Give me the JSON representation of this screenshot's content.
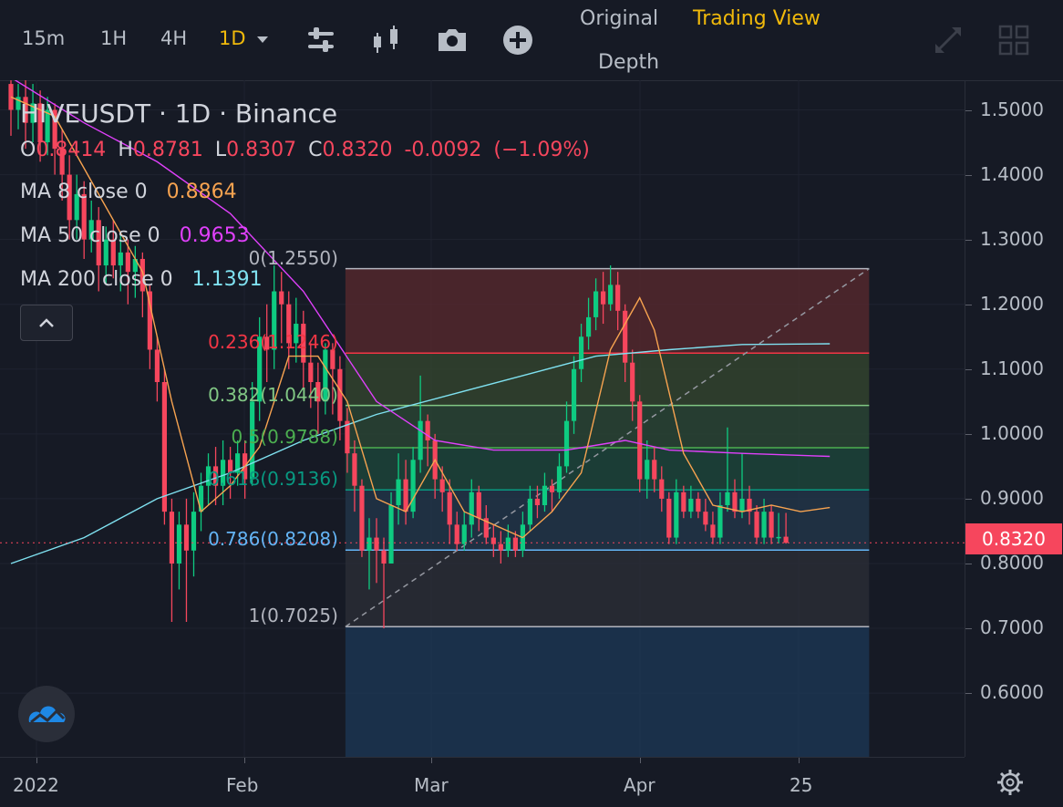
{
  "toolbar": {
    "timeframes": [
      "15m",
      "1H",
      "4H",
      "1D"
    ],
    "active_timeframe": "1D",
    "icons": [
      "indicator-settings-icon",
      "candle-type-icon",
      "camera-icon",
      "add-icon"
    ],
    "tabs": {
      "original": "Original",
      "trading_view": "Trading View",
      "depth": "Depth"
    },
    "right_icons": [
      "fullscreen-icon",
      "layout-grid-icon"
    ]
  },
  "legend": {
    "title": "HIVEUSDT · 1D · Binance",
    "ohlc": {
      "o_label": "O",
      "o": "0.8414",
      "h_label": "H",
      "h": "0.8781",
      "l_label": "L",
      "l": "0.8307",
      "c_label": "C",
      "c": "0.8320",
      "change": "-0.0092",
      "change_pct": "(−1.09%)"
    },
    "ma8": {
      "label": "MA 8 close 0",
      "value": "0.8864",
      "color": "#f7a350"
    },
    "ma50": {
      "label": "MA 50 close 0",
      "value": "0.9653",
      "color": "#e040fb"
    },
    "ma200": {
      "label": "MA 200 close 0",
      "value": "1.1391",
      "color": "#7fe1f0"
    }
  },
  "price_axis": {
    "labels": [
      "1.5000",
      "1.4000",
      "1.3000",
      "1.2000",
      "1.1000",
      "1.0000",
      "0.9000",
      "0.8000",
      "0.7000",
      "0.6000"
    ],
    "current_price": "0.8320"
  },
  "time_axis": {
    "labels": [
      "2022",
      "Feb",
      "Mar",
      "Apr",
      "25"
    ]
  },
  "fib_levels": [
    {
      "label": "0(1.2550)",
      "color": "#b2b5be"
    },
    {
      "label": "0.236(1.1246)",
      "color": "#f23645"
    },
    {
      "label": "0.382(1.0440)",
      "color": "#81c784"
    },
    {
      "label": "0.5(0.9788)",
      "color": "#4caf50"
    },
    {
      "label": "0.618(0.9136)",
      "color": "#089981"
    },
    {
      "label": "0.786(0.8208)",
      "color": "#64b5f6"
    },
    {
      "label": "1(0.7025)",
      "color": "#b2b5be"
    }
  ],
  "colors": {
    "up": "#0ecb81",
    "down": "#f6465d",
    "accent": "#f0b90b",
    "background": "#161a25"
  },
  "chart_data": {
    "type": "candlestick",
    "symbol": "HIVEUSDT",
    "interval": "1D",
    "ylim": [
      0.5,
      1.54
    ],
    "candles": [
      {
        "o": 1.54,
        "c": 1.5,
        "h": 1.56,
        "l": 1.46
      },
      {
        "o": 1.5,
        "c": 1.52,
        "h": 1.54,
        "l": 1.47
      },
      {
        "o": 1.52,
        "c": 1.48,
        "h": 1.55,
        "l": 1.44
      },
      {
        "o": 1.48,
        "c": 1.51,
        "h": 1.54,
        "l": 1.45
      },
      {
        "o": 1.51,
        "c": 1.45,
        "h": 1.53,
        "l": 1.42
      },
      {
        "o": 1.45,
        "c": 1.5,
        "h": 1.52,
        "l": 1.43
      },
      {
        "o": 1.5,
        "c": 1.44,
        "h": 1.51,
        "l": 1.4
      },
      {
        "o": 1.44,
        "c": 1.4,
        "h": 1.47,
        "l": 1.36
      },
      {
        "o": 1.4,
        "c": 1.33,
        "h": 1.43,
        "l": 1.3
      },
      {
        "o": 1.33,
        "c": 1.37,
        "h": 1.4,
        "l": 1.3
      },
      {
        "o": 1.37,
        "c": 1.3,
        "h": 1.39,
        "l": 1.27
      },
      {
        "o": 1.3,
        "c": 1.33,
        "h": 1.36,
        "l": 1.28
      },
      {
        "o": 1.33,
        "c": 1.26,
        "h": 1.35,
        "l": 1.22
      },
      {
        "o": 1.26,
        "c": 1.3,
        "h": 1.32,
        "l": 1.23
      },
      {
        "o": 1.3,
        "c": 1.26,
        "h": 1.33,
        "l": 1.24
      },
      {
        "o": 1.26,
        "c": 1.28,
        "h": 1.31,
        "l": 1.22
      },
      {
        "o": 1.28,
        "c": 1.25,
        "h": 1.3,
        "l": 1.2
      },
      {
        "o": 1.25,
        "c": 1.27,
        "h": 1.29,
        "l": 1.21
      },
      {
        "o": 1.27,
        "c": 1.22,
        "h": 1.28,
        "l": 1.18
      },
      {
        "o": 1.22,
        "c": 1.13,
        "h": 1.23,
        "l": 1.1
      },
      {
        "o": 1.13,
        "c": 1.08,
        "h": 1.15,
        "l": 1.05
      },
      {
        "o": 1.08,
        "c": 0.88,
        "h": 1.1,
        "l": 0.86
      },
      {
        "o": 0.88,
        "c": 0.8,
        "h": 0.9,
        "l": 0.71
      },
      {
        "o": 0.8,
        "c": 0.86,
        "h": 0.88,
        "l": 0.76
      },
      {
        "o": 0.86,
        "c": 0.82,
        "h": 0.9,
        "l": 0.71
      },
      {
        "o": 0.82,
        "c": 0.88,
        "h": 0.91,
        "l": 0.78
      },
      {
        "o": 0.88,
        "c": 0.92,
        "h": 0.94,
        "l": 0.85
      },
      {
        "o": 0.92,
        "c": 0.95,
        "h": 0.97,
        "l": 0.89
      },
      {
        "o": 0.95,
        "c": 0.92,
        "h": 0.98,
        "l": 0.89
      },
      {
        "o": 0.92,
        "c": 0.96,
        "h": 0.99,
        "l": 0.89
      },
      {
        "o": 0.96,
        "c": 0.94,
        "h": 0.98,
        "l": 0.9
      },
      {
        "o": 0.94,
        "c": 0.97,
        "h": 0.99,
        "l": 0.92
      },
      {
        "o": 0.97,
        "c": 0.93,
        "h": 0.99,
        "l": 0.9
      },
      {
        "o": 0.93,
        "c": 1.05,
        "h": 1.08,
        "l": 0.92
      },
      {
        "o": 1.05,
        "c": 1.15,
        "h": 1.18,
        "l": 1.02
      },
      {
        "o": 1.15,
        "c": 1.13,
        "h": 1.2,
        "l": 1.08
      },
      {
        "o": 1.13,
        "c": 1.22,
        "h": 1.26,
        "l": 1.1
      },
      {
        "o": 1.22,
        "c": 1.2,
        "h": 1.25,
        "l": 1.14
      },
      {
        "o": 1.2,
        "c": 1.14,
        "h": 1.22,
        "l": 1.1
      },
      {
        "o": 1.14,
        "c": 1.17,
        "h": 1.21,
        "l": 1.11
      },
      {
        "o": 1.17,
        "c": 1.11,
        "h": 1.19,
        "l": 1.07
      },
      {
        "o": 1.11,
        "c": 1.08,
        "h": 1.14,
        "l": 1.04
      },
      {
        "o": 1.08,
        "c": 1.05,
        "h": 1.11,
        "l": 1.0
      },
      {
        "o": 1.05,
        "c": 1.13,
        "h": 1.14,
        "l": 1.03
      },
      {
        "o": 1.13,
        "c": 1.1,
        "h": 1.14,
        "l": 1.03
      },
      {
        "o": 1.1,
        "c": 1.02,
        "h": 1.12,
        "l": 0.99
      },
      {
        "o": 1.02,
        "c": 0.97,
        "h": 1.04,
        "l": 0.94
      },
      {
        "o": 0.97,
        "c": 0.92,
        "h": 0.99,
        "l": 0.88
      },
      {
        "o": 0.92,
        "c": 0.82,
        "h": 0.93,
        "l": 0.81
      },
      {
        "o": 0.82,
        "c": 0.84,
        "h": 0.87,
        "l": 0.76
      },
      {
        "o": 0.84,
        "c": 0.82,
        "h": 0.87,
        "l": 0.77
      },
      {
        "o": 0.82,
        "c": 0.8,
        "h": 0.84,
        "l": 0.7
      },
      {
        "o": 0.8,
        "c": 0.89,
        "h": 0.91,
        "l": 0.8
      },
      {
        "o": 0.89,
        "c": 0.93,
        "h": 0.97,
        "l": 0.86
      },
      {
        "o": 0.93,
        "c": 0.88,
        "h": 0.96,
        "l": 0.86
      },
      {
        "o": 0.88,
        "c": 0.96,
        "h": 0.98,
        "l": 0.87
      },
      {
        "o": 0.96,
        "c": 1.02,
        "h": 1.09,
        "l": 0.94
      },
      {
        "o": 1.02,
        "c": 0.99,
        "h": 1.03,
        "l": 0.95
      },
      {
        "o": 0.99,
        "c": 0.93,
        "h": 1.0,
        "l": 0.9
      },
      {
        "o": 0.93,
        "c": 0.91,
        "h": 0.95,
        "l": 0.88
      },
      {
        "o": 0.91,
        "c": 0.86,
        "h": 0.93,
        "l": 0.83
      },
      {
        "o": 0.86,
        "c": 0.83,
        "h": 0.88,
        "l": 0.82
      },
      {
        "o": 0.83,
        "c": 0.86,
        "h": 0.88,
        "l": 0.82
      },
      {
        "o": 0.86,
        "c": 0.91,
        "h": 0.93,
        "l": 0.84
      },
      {
        "o": 0.91,
        "c": 0.87,
        "h": 0.92,
        "l": 0.85
      },
      {
        "o": 0.87,
        "c": 0.84,
        "h": 0.89,
        "l": 0.83
      },
      {
        "o": 0.84,
        "c": 0.83,
        "h": 0.86,
        "l": 0.81
      },
      {
        "o": 0.83,
        "c": 0.82,
        "h": 0.85,
        "l": 0.8
      },
      {
        "o": 0.82,
        "c": 0.84,
        "h": 0.86,
        "l": 0.81
      },
      {
        "o": 0.84,
        "c": 0.82,
        "h": 0.85,
        "l": 0.81
      },
      {
        "o": 0.82,
        "c": 0.86,
        "h": 0.88,
        "l": 0.81
      },
      {
        "o": 0.86,
        "c": 0.9,
        "h": 0.92,
        "l": 0.85
      },
      {
        "o": 0.9,
        "c": 0.89,
        "h": 0.92,
        "l": 0.87
      },
      {
        "o": 0.89,
        "c": 0.92,
        "h": 0.94,
        "l": 0.88
      },
      {
        "o": 0.92,
        "c": 0.91,
        "h": 0.93,
        "l": 0.88
      },
      {
        "o": 0.91,
        "c": 0.95,
        "h": 0.97,
        "l": 0.9
      },
      {
        "o": 0.95,
        "c": 1.02,
        "h": 1.05,
        "l": 0.94
      },
      {
        "o": 1.02,
        "c": 1.1,
        "h": 1.12,
        "l": 1.0
      },
      {
        "o": 1.1,
        "c": 1.15,
        "h": 1.17,
        "l": 1.08
      },
      {
        "o": 1.15,
        "c": 1.18,
        "h": 1.21,
        "l": 1.13
      },
      {
        "o": 1.18,
        "c": 1.22,
        "h": 1.24,
        "l": 1.16
      },
      {
        "o": 1.22,
        "c": 1.2,
        "h": 1.25,
        "l": 1.17
      },
      {
        "o": 1.2,
        "c": 1.23,
        "h": 1.26,
        "l": 1.19
      },
      {
        "o": 1.23,
        "c": 1.19,
        "h": 1.25,
        "l": 1.16
      },
      {
        "o": 1.19,
        "c": 1.11,
        "h": 1.2,
        "l": 1.08
      },
      {
        "o": 1.11,
        "c": 1.05,
        "h": 1.13,
        "l": 1.02
      },
      {
        "o": 1.05,
        "c": 0.93,
        "h": 1.06,
        "l": 0.91
      },
      {
        "o": 0.93,
        "c": 0.96,
        "h": 0.99,
        "l": 0.9
      },
      {
        "o": 0.96,
        "c": 0.93,
        "h": 0.98,
        "l": 0.91
      },
      {
        "o": 0.93,
        "c": 0.9,
        "h": 0.95,
        "l": 0.88
      },
      {
        "o": 0.9,
        "c": 0.84,
        "h": 0.91,
        "l": 0.83
      },
      {
        "o": 0.84,
        "c": 0.91,
        "h": 0.93,
        "l": 0.83
      },
      {
        "o": 0.91,
        "c": 0.88,
        "h": 0.92,
        "l": 0.87
      },
      {
        "o": 0.88,
        "c": 0.9,
        "h": 0.92,
        "l": 0.87
      },
      {
        "o": 0.9,
        "c": 0.88,
        "h": 0.91,
        "l": 0.87
      },
      {
        "o": 0.88,
        "c": 0.86,
        "h": 0.9,
        "l": 0.85
      },
      {
        "o": 0.86,
        "c": 0.84,
        "h": 0.88,
        "l": 0.83
      },
      {
        "o": 0.84,
        "c": 0.89,
        "h": 0.91,
        "l": 0.83
      },
      {
        "o": 0.89,
        "c": 0.91,
        "h": 1.01,
        "l": 0.88
      },
      {
        "o": 0.91,
        "c": 0.88,
        "h": 0.93,
        "l": 0.87
      },
      {
        "o": 0.88,
        "c": 0.9,
        "h": 0.97,
        "l": 0.87
      },
      {
        "o": 0.9,
        "c": 0.88,
        "h": 0.92,
        "l": 0.86
      },
      {
        "o": 0.88,
        "c": 0.84,
        "h": 0.89,
        "l": 0.83
      },
      {
        "o": 0.84,
        "c": 0.88,
        "h": 0.9,
        "l": 0.83
      },
      {
        "o": 0.88,
        "c": 0.84,
        "h": 0.89,
        "l": 0.83
      },
      {
        "o": 0.84,
        "c": 0.841,
        "h": 0.878,
        "l": 0.831
      },
      {
        "o": 0.8414,
        "c": 0.832,
        "h": 0.8781,
        "l": 0.8307
      }
    ],
    "ma8_points": [
      [
        0,
        1.52
      ],
      [
        6,
        1.49
      ],
      [
        12,
        1.37
      ],
      [
        18,
        1.25
      ],
      [
        22,
        1.05
      ],
      [
        26,
        0.88
      ],
      [
        30,
        0.92
      ],
      [
        34,
        0.98
      ],
      [
        38,
        1.12
      ],
      [
        42,
        1.12
      ],
      [
        46,
        1.05
      ],
      [
        50,
        0.9
      ],
      [
        54,
        0.88
      ],
      [
        58,
        0.96
      ],
      [
        62,
        0.88
      ],
      [
        66,
        0.86
      ],
      [
        70,
        0.84
      ],
      [
        74,
        0.88
      ],
      [
        78,
        0.94
      ],
      [
        82,
        1.13
      ],
      [
        86,
        1.21
      ],
      [
        88,
        1.16
      ],
      [
        92,
        0.97
      ],
      [
        96,
        0.89
      ],
      [
        100,
        0.88
      ],
      [
        104,
        0.89
      ],
      [
        108,
        0.88
      ],
      [
        112,
        0.8864
      ]
    ],
    "ma50_points": [
      [
        0,
        1.55
      ],
      [
        10,
        1.48
      ],
      [
        20,
        1.42
      ],
      [
        30,
        1.34
      ],
      [
        40,
        1.22
      ],
      [
        50,
        1.05
      ],
      [
        58,
        0.99
      ],
      [
        66,
        0.975
      ],
      [
        76,
        0.975
      ],
      [
        84,
        0.99
      ],
      [
        90,
        0.975
      ],
      [
        100,
        0.97
      ],
      [
        112,
        0.9653
      ]
    ],
    "ma200_points": [
      [
        0,
        0.8
      ],
      [
        10,
        0.84
      ],
      [
        20,
        0.9
      ],
      [
        30,
        0.94
      ],
      [
        40,
        0.99
      ],
      [
        50,
        1.03
      ],
      [
        60,
        1.06
      ],
      [
        70,
        1.09
      ],
      [
        80,
        1.12
      ],
      [
        90,
        1.13
      ],
      [
        100,
        1.138
      ],
      [
        112,
        1.1391
      ]
    ],
    "fib": {
      "start_index": 45,
      "end_index": 117,
      "high": 1.255,
      "low": 0.7025,
      "levels": [
        0,
        0.236,
        0.382,
        0.5,
        0.618,
        0.786,
        1
      ]
    }
  }
}
